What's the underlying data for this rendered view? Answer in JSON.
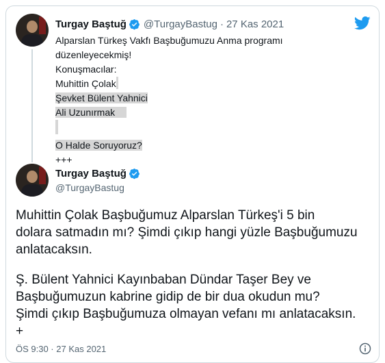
{
  "quoted_tweet": {
    "author_name": "Turgay Baştuğ",
    "handle": "@TurgayBastug",
    "date": "27 Kas 2021",
    "lines": [
      "Alparslan Türkeş Vakfı Başbuğumuzu Anma programı",
      "düzenleyecekmiş!",
      "Konuşmacılar:",
      "Muhittin Çolak",
      "Şevket Bülent Yahnici",
      "Ali Uzunırmak",
      "",
      "O Halde Soruyoruz?",
      "+++"
    ]
  },
  "main_tweet": {
    "author_name": "Turgay Baştuğ",
    "handle": "@TurgayBastug",
    "lines_para1": [
      "Muhittin Çolak Başbuğumuz Alparslan Türkeş'i 5 bin",
      "dolara satmadın mı? Şimdi çıkıp hangi yüzle Başbuğumuzu",
      "anlatacaksın."
    ],
    "lines_para2": [
      "Ş. Bülent Yahnici Kayınbaban Dündar Taşer Bey ve",
      "Başbuğumuzun kabrine gidip de bir dua okudun mu?",
      "Şimdi çıkıp Başbuğumuza olmayan vefanı mı anlatacaksın.",
      "+"
    ],
    "timestamp": "ÖS 9:30 · 27 Kas 2021"
  },
  "icons": {
    "brand": "twitter-bird-icon",
    "verified": "verified-badge-icon",
    "info": "info-icon"
  },
  "colors": {
    "twitter_blue": "#1d9bf0",
    "secondary_text": "#536471",
    "highlight": "#d6d6d6"
  }
}
